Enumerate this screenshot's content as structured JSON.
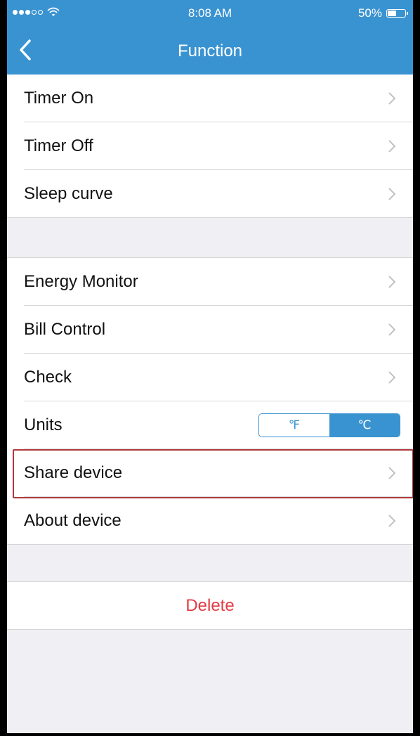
{
  "status_bar": {
    "time": "8:08 AM",
    "battery_text": "50%",
    "battery_level": 0.5,
    "signal_dots_filled": 3,
    "signal_dots_total": 5
  },
  "nav": {
    "title": "Function",
    "back_icon": "chevron-left-icon"
  },
  "groups": [
    [
      {
        "label": "Timer On"
      },
      {
        "label": "Timer Off"
      },
      {
        "label": "Sleep curve"
      }
    ],
    [
      {
        "label": "Energy Monitor"
      },
      {
        "label": "Bill Control"
      },
      {
        "label": "Check"
      },
      {
        "label": "Units",
        "toggle": {
          "options": [
            "℉",
            "℃"
          ],
          "selected": "℃"
        }
      },
      {
        "label": "Share device",
        "highlighted": true
      },
      {
        "label": "About device"
      }
    ]
  ],
  "delete_label": "Delete",
  "colors": {
    "accent": "#3a93d1",
    "delete": "#e33b43",
    "highlight_border": "#b03a3e",
    "background": "#efeff4"
  }
}
